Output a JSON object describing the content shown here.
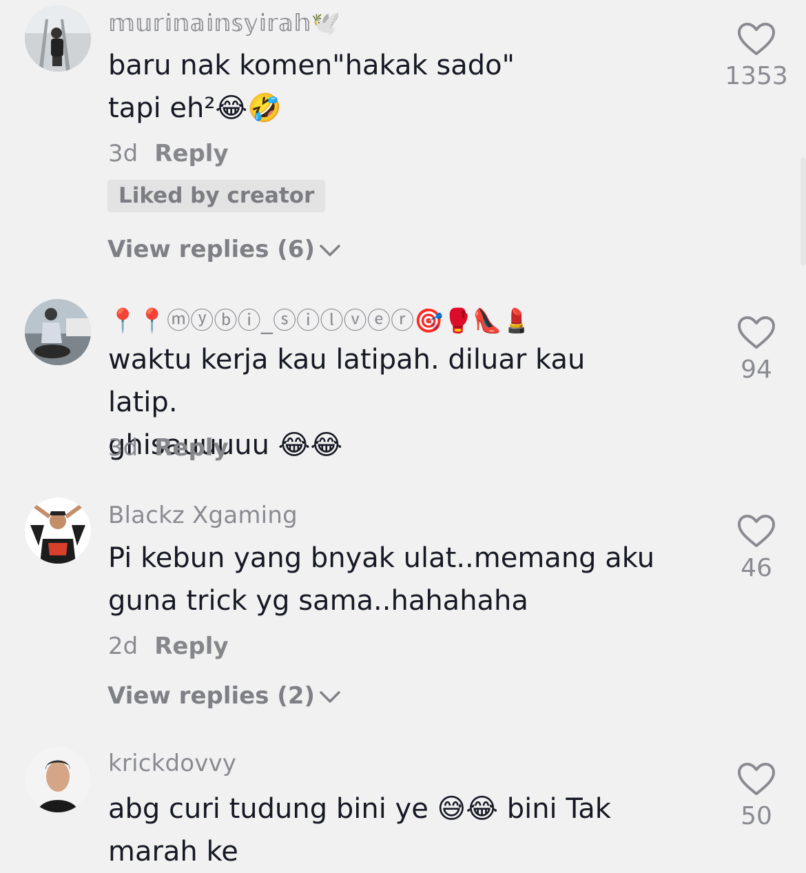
{
  "comments": [
    {
      "username": "𝕞𝕦𝕣𝕚𝕟𝕒𝕚𝕟𝕤𝕪𝕚𝕣𝕒𝕙",
      "username_suffix": "🕊️",
      "line1": "baru nak komen\"hakak sado\"",
      "line2": "tapi eh²😂🤣",
      "age": "3d",
      "reply_label": "Reply",
      "liked_by_creator": "Liked by creator",
      "view_replies": "View replies (6)",
      "likes": "1353"
    },
    {
      "username": "📍📍ⓜⓨⓑⓘ_ⓢⓘⓛⓥⓔⓡ🎯🥊👠💄",
      "line1": "waktu kerja kau latipah. diluar kau latip.",
      "line2": "ghisauuuuu 😂😂",
      "age": "3d",
      "reply_label": "Reply",
      "likes": "94"
    },
    {
      "username": "Blackz Xgaming",
      "line1": "Pi kebun yang bnyak ulat..memang aku",
      "line2": "guna trick yg sama..hahahaha",
      "age": "2d",
      "reply_label": "Reply",
      "view_replies": "View replies (2)",
      "likes": "46"
    },
    {
      "username": "krickdovvy",
      "line1": "abg curi tudung bini ye 😅😂 bini Tak",
      "line2": "marah ke",
      "likes": "50"
    }
  ],
  "icons": {
    "like": "heart-outline-icon",
    "expand": "chevron-down-icon"
  },
  "colors": {
    "background": "#f1f1f1",
    "text": "#161823",
    "secondary": "#8a8b91"
  }
}
